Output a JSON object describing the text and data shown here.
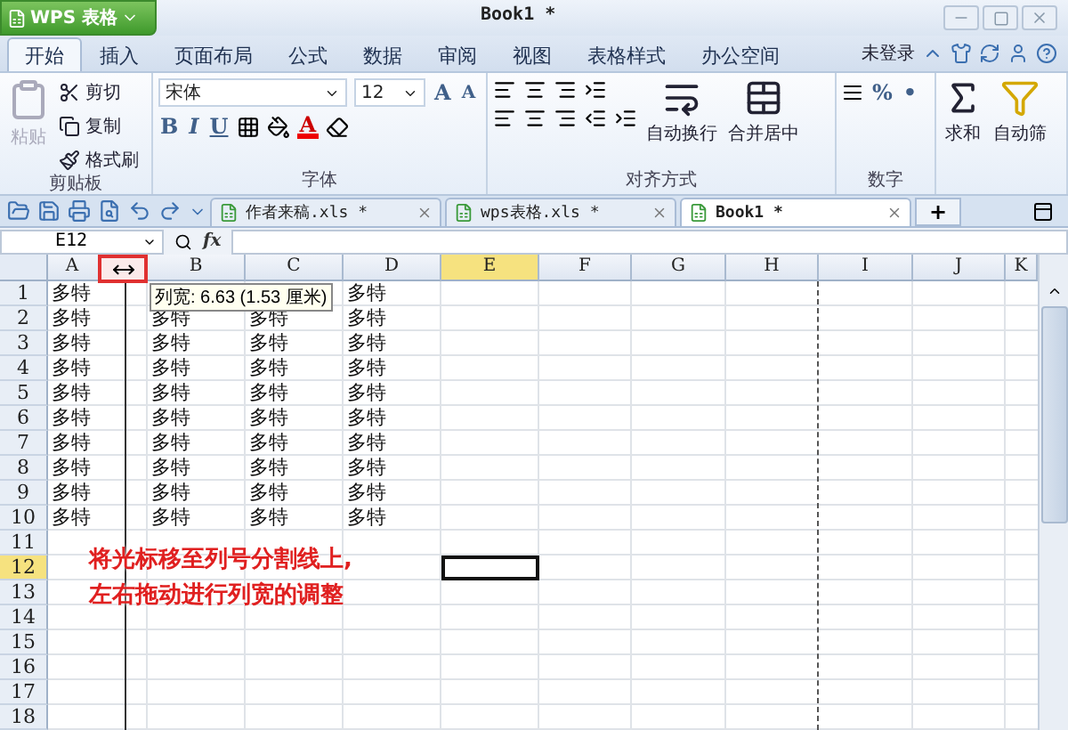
{
  "app_button": "WPS 表格",
  "window": {
    "title": "Book1 *"
  },
  "ribbon_tabs": [
    {
      "label": "开始",
      "selected": true
    },
    {
      "label": "插入",
      "selected": false
    },
    {
      "label": "页面布局",
      "selected": false
    },
    {
      "label": "公式",
      "selected": false
    },
    {
      "label": "数据",
      "selected": false
    },
    {
      "label": "审阅",
      "selected": false
    },
    {
      "label": "视图",
      "selected": false
    },
    {
      "label": "表格样式",
      "selected": false
    },
    {
      "label": "办公空间",
      "selected": false
    }
  ],
  "account": "未登录",
  "clipboard": {
    "paste": "粘贴",
    "cut": "剪切",
    "copy": "复制",
    "format_painter": "格式刷",
    "label": "剪贴板"
  },
  "font": {
    "name": "宋体",
    "size": "12",
    "grow_label": "A",
    "shrink_label": "A",
    "bold": "B",
    "italic": "I",
    "underline": "U",
    "text_color_label": "A",
    "label": "字体"
  },
  "alignment": {
    "wrap": "自动换行",
    "merge": "合并居中",
    "label": "对齐方式"
  },
  "number": {
    "percent": "%",
    "comma": "•",
    "label": "数字"
  },
  "editing": {
    "sum": "求和",
    "filter": "自动筛"
  },
  "doc_tabs": [
    {
      "title": "作者来稿.xls *",
      "selected": false
    },
    {
      "title": "wps表格.xls *",
      "selected": false
    },
    {
      "title": "Book1 *",
      "selected": true
    }
  ],
  "new_tab": "+",
  "name_box": "E12",
  "formula_label": "fx",
  "columns": [
    {
      "label": "A",
      "selected": false
    },
    {
      "label": "B",
      "selected": false
    },
    {
      "label": "C",
      "selected": false
    },
    {
      "label": "D",
      "selected": false
    },
    {
      "label": "E",
      "selected": true
    },
    {
      "label": "F",
      "selected": false
    },
    {
      "label": "G",
      "selected": false
    },
    {
      "label": "H",
      "selected": false
    },
    {
      "label": "I",
      "selected": false
    },
    {
      "label": "J",
      "selected": false
    },
    {
      "label": "K",
      "selected": false
    }
  ],
  "rows": [
    {
      "label": "1",
      "selected": false,
      "cells": [
        "多特",
        null,
        null,
        "多特"
      ]
    },
    {
      "label": "2",
      "selected": false,
      "cells": [
        "多特",
        "多特",
        "多特",
        "多特"
      ]
    },
    {
      "label": "3",
      "selected": false,
      "cells": [
        "多特",
        "多特",
        "多特",
        "多特"
      ]
    },
    {
      "label": "4",
      "selected": false,
      "cells": [
        "多特",
        "多特",
        "多特",
        "多特"
      ]
    },
    {
      "label": "5",
      "selected": false,
      "cells": [
        "多特",
        "多特",
        "多特",
        "多特"
      ]
    },
    {
      "label": "6",
      "selected": false,
      "cells": [
        "多特",
        "多特",
        "多特",
        "多特"
      ]
    },
    {
      "label": "7",
      "selected": false,
      "cells": [
        "多特",
        "多特",
        "多特",
        "多特"
      ]
    },
    {
      "label": "8",
      "selected": false,
      "cells": [
        "多特",
        "多特",
        "多特",
        "多特"
      ]
    },
    {
      "label": "9",
      "selected": false,
      "cells": [
        "多特",
        "多特",
        "多特",
        "多特"
      ]
    },
    {
      "label": "10",
      "selected": false,
      "cells": [
        "多特",
        "多特",
        "多特",
        "多特"
      ]
    },
    {
      "label": "11",
      "selected": false,
      "cells": []
    },
    {
      "label": "12",
      "selected": true,
      "cells": []
    },
    {
      "label": "13",
      "selected": false,
      "cells": []
    },
    {
      "label": "14",
      "selected": false,
      "cells": []
    },
    {
      "label": "15",
      "selected": false,
      "cells": []
    },
    {
      "label": "16",
      "selected": false,
      "cells": []
    },
    {
      "label": "17",
      "selected": false,
      "cells": []
    },
    {
      "label": "18",
      "selected": false,
      "cells": []
    }
  ],
  "tooltip": "列宽: 6.63 (1.53 厘米)",
  "annotation": [
    "将光标移至列号分割线上,",
    "左右拖动进行列宽的调整"
  ]
}
